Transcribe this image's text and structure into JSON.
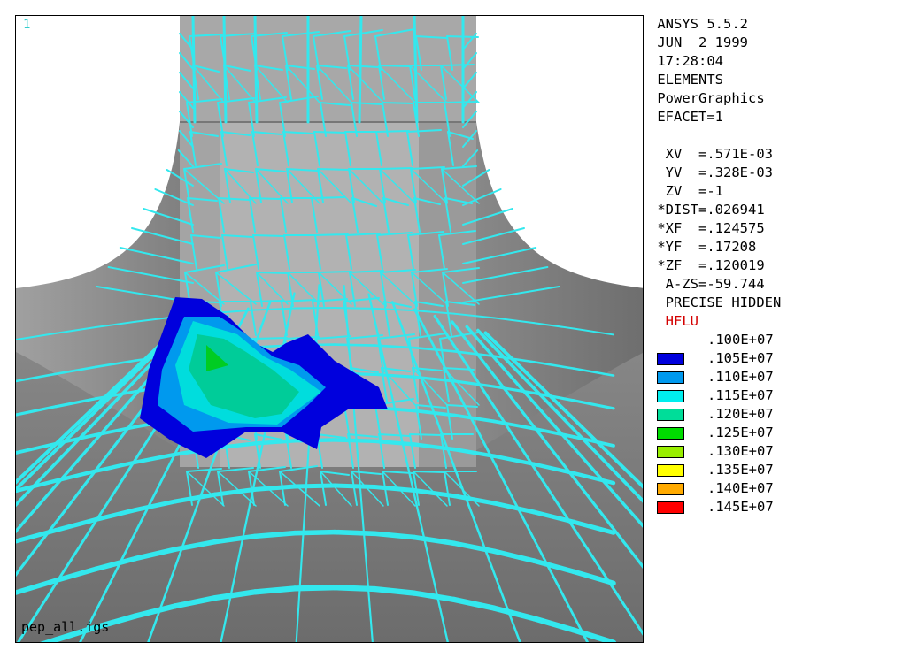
{
  "window": {
    "number": "1",
    "file_label": "pep_all.igs"
  },
  "info": {
    "lines": [
      " ANSYS 5.5.2",
      " JUN  2 1999",
      " 17:28:04",
      " ELEMENTS",
      " PowerGraphics",
      " EFACET=1"
    ],
    "view_lines": [
      "  XV  =.571E-03",
      "  YV  =.328E-03",
      "  ZV  =-1",
      " *DIST=.026941",
      " *XF  =.124575",
      " *YF  =.17208",
      " *ZF  =.120019",
      "  A-ZS=-59.744",
      "  PRECISE HIDDEN"
    ],
    "result_label": "  HFLU"
  },
  "legend": {
    "top_value": ".100E+07",
    "entries": [
      {
        "color": "#0000dd",
        "value": ".105E+07"
      },
      {
        "color": "#0099ee",
        "value": ".110E+07"
      },
      {
        "color": "#00eeee",
        "value": ".115E+07"
      },
      {
        "color": "#00dd99",
        "value": ".120E+07"
      },
      {
        "color": "#00dd00",
        "value": ".125E+07"
      },
      {
        "color": "#99ee00",
        "value": ".130E+07"
      },
      {
        "color": "#ffff00",
        "value": ".135E+07"
      },
      {
        "color": "#ffaa00",
        "value": ".140E+07"
      },
      {
        "color": "#ff0000",
        "value": ".145E+07"
      }
    ]
  },
  "colors": {
    "mesh_line": "#33e8ee",
    "surface_dark": "#7a7a7a",
    "surface_light": "#b4b4b4"
  }
}
